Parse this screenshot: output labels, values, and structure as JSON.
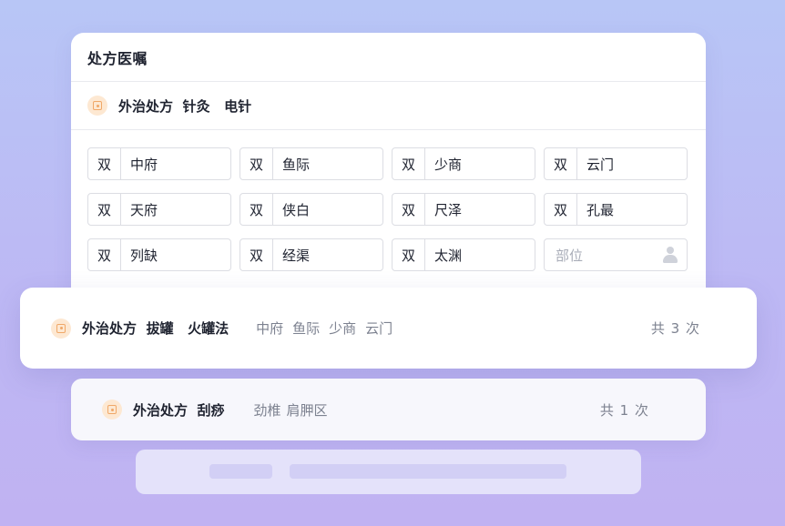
{
  "main_card": {
    "title": "处方医嘱",
    "prescription_label": "外治处方  针灸   电针",
    "acupoints": [
      {
        "side": "双",
        "name": "中府"
      },
      {
        "side": "双",
        "name": "鱼际"
      },
      {
        "side": "双",
        "name": "少商"
      },
      {
        "side": "双",
        "name": "云门"
      },
      {
        "side": "双",
        "name": "天府"
      },
      {
        "side": "双",
        "name": "侠白"
      },
      {
        "side": "双",
        "name": "尺泽"
      },
      {
        "side": "双",
        "name": "孔最"
      },
      {
        "side": "双",
        "name": "列缺"
      },
      {
        "side": "双",
        "name": "经渠"
      },
      {
        "side": "双",
        "name": "太渊"
      }
    ],
    "placeholder": "部位"
  },
  "cupping": {
    "label": "外治处方  拔罐   火罐法",
    "points": [
      "中府",
      "鱼际",
      "少商",
      "云门"
    ],
    "count": "共 3 次"
  },
  "gua_sha": {
    "label": "外治处方  刮痧",
    "points": [
      "劲椎",
      "肩胛区"
    ],
    "count": "共 1 次"
  },
  "colors": {
    "accent_orange": "#f0a868",
    "icon_bg": "#fde8d2"
  }
}
